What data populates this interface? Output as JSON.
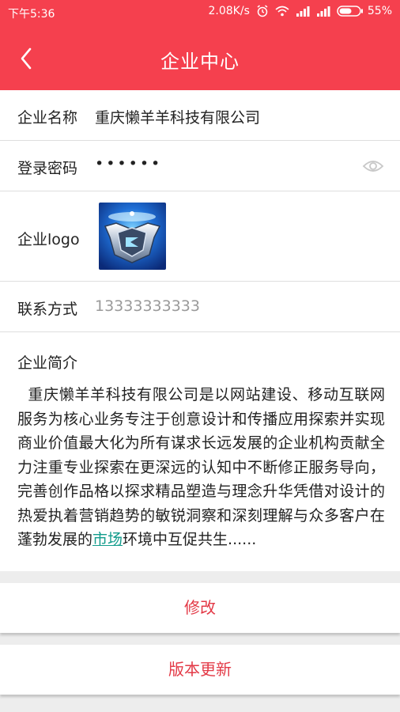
{
  "status_bar": {
    "time": "下午5:36",
    "speed": "2.08K/s",
    "battery": "55%"
  },
  "header": {
    "title": "企业中心"
  },
  "company": {
    "name_label": "企业名称",
    "name_value": "重庆懒羊羊科技有限公司",
    "password_label": "登录密码",
    "password_value": "••••••",
    "logo_label": "企业logo",
    "contact_label": "联系方式",
    "contact_value": "13333333333",
    "intro_label": "企业简介",
    "intro_text_before": "重庆懒羊羊科技有限公司是以网站建设、移动互联网服务为核心业务专注于创意设计和传播应用探索并实现商业价值最大化为所有谋求长远发展的企业机构贡献全力注重专业探索在更深远的认知中不断修正服务导向，完善创作品格以探求精品塑造与理念升华凭借对设计的热爱执着营销趋势的敏锐洞察和深刻理解与众多客户在蓬勃发展的",
    "intro_link": "市场",
    "intro_text_after": "环境中互促共生......"
  },
  "buttons": {
    "edit": "修改",
    "update": "版本更新"
  },
  "colors": {
    "header": "#f5404e",
    "button_text": "#e33a47",
    "link": "#139c8c"
  }
}
